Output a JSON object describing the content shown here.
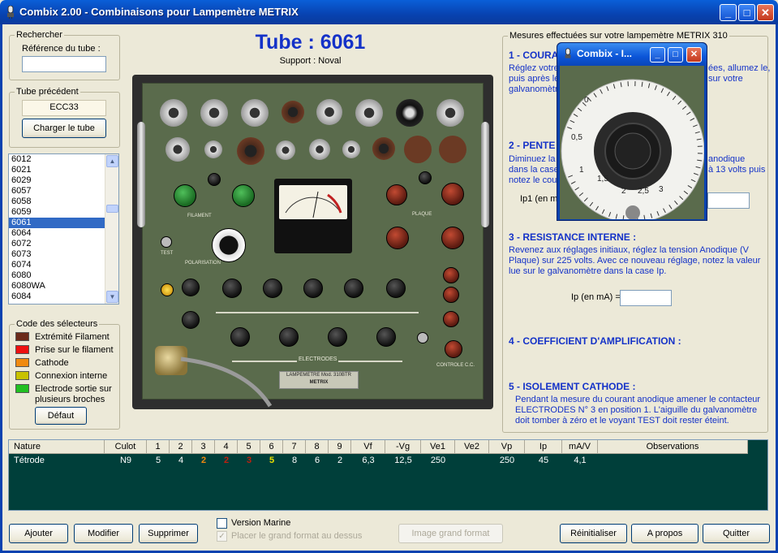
{
  "window": {
    "title": "Combix 2.00 - Combinaisons pour Lampemètre METRIX",
    "min_label": "_",
    "max_label": "□",
    "close_label": "✕"
  },
  "search": {
    "group_label": "Rechercher",
    "field_label": "Référence du tube :",
    "value": ""
  },
  "previous": {
    "group_label": "Tube précédent",
    "value": "ECC33",
    "load_button": "Charger le tube"
  },
  "tube_list": {
    "items": [
      "6012",
      "6021",
      "6029",
      "6057",
      "6058",
      "6059",
      "6061",
      "6064",
      "6072",
      "6073",
      "6074",
      "6080",
      "6080WA",
      "6084"
    ],
    "selected": "6061"
  },
  "legend_codes": {
    "group_label": "Code des sélecteurs",
    "items": [
      {
        "label": "Extrémité Filament",
        "color": "#6b2a1a"
      },
      {
        "label": "Prise sur le filament",
        "color": "#ee1111"
      },
      {
        "label": "Cathode",
        "color": "#f08a10"
      },
      {
        "label": "Connexion interne",
        "color": "#c8c200"
      },
      {
        "label": "Electrode sortie sur",
        "label2": "plusieurs broches",
        "color": "#22c022"
      }
    ],
    "default_button": "Défaut"
  },
  "center": {
    "tube_title": "Tube : 6061",
    "support": "Support : Noval",
    "panel_labels": {
      "filament": "FILAMENT",
      "plaque": "PLAQUE",
      "polarisation": "POLARISATION",
      "test": "TEST",
      "electrodes": "ELECTRODES",
      "brand_plate": "LAMPEMETRE Mod. 310BTR",
      "brand": "METRIX",
      "controle": "CONTROLE C.C."
    }
  },
  "measures": {
    "frame_label": "Mesures effectuées sur votre lampemètre METRIX 310",
    "s1_title": "1 - COURA",
    "s1_text1": "Réglez votre",
    "s1_text1b": "ées, allumez le,",
    "s1_text2": "puis après le",
    "s1_text2b": "sur votre",
    "s1_text3": "galvanomètr",
    "s2_title": "2 - PENTE",
    "s2_text1": "Diminuez la",
    "s2_text1b": "anodique",
    "s2_text2": "dans la case",
    "s2_text2b": "à 13 volts puis",
    "s2_text3": "notez le cou",
    "ip1_label": "Ip1 (en m",
    "s3_title": "3 - RESISTANCE INTERNE :",
    "s3_text": [
      "Revenez aux réglages initiaux, réglez la tension Anodique (V",
      "Plaque) sur 225 volts. Avec ce nouveau réglage, notez la valeur",
      "lue sur le galvanomètre dans la case Ip."
    ],
    "ip_label": "Ip (en mA) =",
    "s4_title": "4 - COEFFICIENT D'AMPLIFICATION :",
    "s5_title": "5 - ISOLEMENT CATHODE :",
    "s5_text": [
      "Pendant la mesure du courant anodique amener le contacteur",
      "ELECTRODES N° 3 en position 1. L'aiguille du galvanomètre",
      "doit tomber à zéro et le voyant TEST doit rester éteint."
    ]
  },
  "float_window": {
    "title": "Combix - I...",
    "dial_labels": [
      "0",
      "0,5",
      "1",
      "1,5",
      "2",
      "2,5",
      "3"
    ]
  },
  "table": {
    "headers": [
      "Nature",
      "Culot",
      "1",
      "2",
      "3",
      "4",
      "5",
      "6",
      "7",
      "8",
      "9",
      "Vf",
      "-Vg",
      "Ve1",
      "Ve2",
      "Vp",
      "Ip",
      "mA/V",
      "Observations"
    ],
    "row": [
      "Tétrode",
      "N9",
      "5",
      "4",
      "2",
      "2",
      "3",
      "5",
      "8",
      "6",
      "2",
      "6,3",
      "12,5",
      "250",
      "",
      "250",
      "45",
      "4,1",
      ""
    ],
    "pin_colors": {
      "3": "#f08a10",
      "4": "#c02010",
      "5": "#c02010",
      "6": "#e8e000"
    }
  },
  "bottom": {
    "add": "Ajouter",
    "modify": "Modifier",
    "delete": "Supprimer",
    "marine": "Version Marine",
    "big_format": "Placer le grand format au dessus",
    "image_big": "Image grand format",
    "reset": "Réinitialiser",
    "about": "A propos",
    "quit": "Quitter"
  }
}
